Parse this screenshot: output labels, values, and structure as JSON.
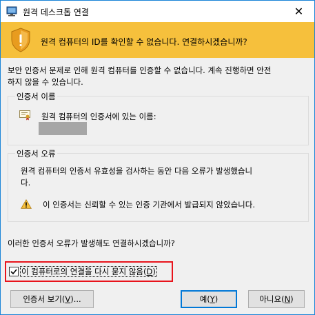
{
  "window": {
    "title": "원격 데스크톱 연결",
    "close_glyph": "✕"
  },
  "banner": {
    "text": "원격 컴퓨터의 ID를 확인할 수 없습니다. 연결하시겠습니까?",
    "color": "#f6c03c"
  },
  "intro": {
    "line1": "보안 인증서 문제로 인해 원격 컴퓨터를 인증할 수 없습니다. 계속 진행하면 안전",
    "line2": "하지 않을 수 있습니다."
  },
  "cert_name_group": {
    "label": "인증서 이름",
    "row_text": "원격 컴퓨터의 인증서에 있는 이름:"
  },
  "cert_error_group": {
    "label": "인증서 오류",
    "desc_line1": "원격 컴퓨터의 인증서 유효성을 검사하는 동안 다음 오류가 발생했습니",
    "desc_line2": "다.",
    "error_text": "이 인증서는 신뢰할 수 있는 인증 기관에서 발급되지 않았습니다."
  },
  "question": "이러한 인증서 오류가 발생해도 연결하시겠습니까?",
  "checkbox": {
    "checked": true,
    "label_main": "이 컴퓨터로의 연결을 다시 묻지 않음(",
    "label_key": "D",
    "label_end": ")"
  },
  "buttons": {
    "view_cert_main": "인증서 보기(",
    "view_cert_key": "V",
    "view_cert_end": ")...",
    "yes_main": "예(",
    "yes_key": "Y",
    "yes_end": ")",
    "no_main": "아니요(",
    "no_key": "N",
    "no_end": ")"
  },
  "colors": {
    "highlight_box": "#e8131b",
    "default_button_border": "#0078d7"
  }
}
